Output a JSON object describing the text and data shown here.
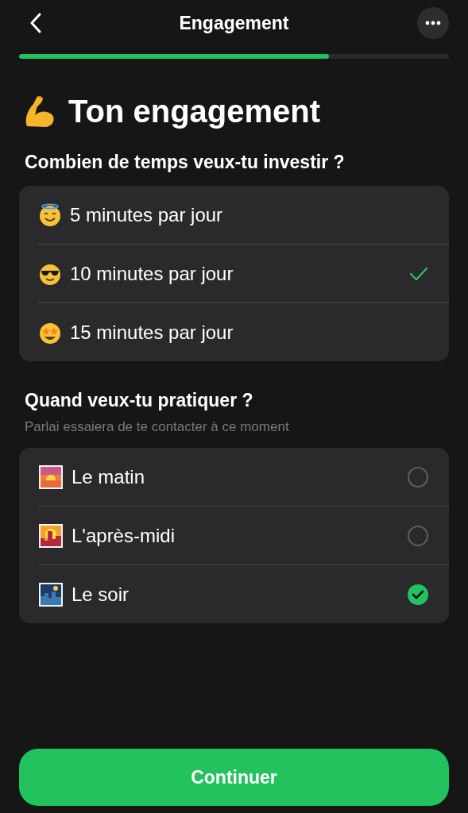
{
  "nav": {
    "title": "Engagement"
  },
  "progress": {
    "level": 0.72
  },
  "heading": {
    "title": "Ton engagement"
  },
  "duration": {
    "question": "Combien de temps veux-tu investir ?",
    "options": [
      {
        "label": "5 minutes par jour",
        "selected": false
      },
      {
        "label": "10 minutes par jour",
        "selected": true
      },
      {
        "label": "15 minutes par jour",
        "selected": false
      }
    ]
  },
  "time_of_day": {
    "question": "Quand veux-tu pratiquer ?",
    "hint": "Parlai essaiera de te contacter à ce moment",
    "options": [
      {
        "label": "Le matin",
        "selected": false
      },
      {
        "label": "L'après-midi",
        "selected": false
      },
      {
        "label": "Le soir",
        "selected": true
      }
    ]
  },
  "continue_button": {
    "label": "Continuer"
  }
}
